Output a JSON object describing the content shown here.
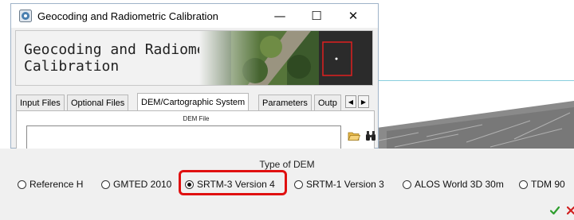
{
  "window": {
    "title": "Geocoding and Radiometric Calibration",
    "controls": {
      "minimize": "—",
      "maximize": "☐",
      "close": "✕"
    }
  },
  "banner": {
    "title": "Geocoding and Radiometric\nCalibration"
  },
  "tabs": [
    {
      "label": "Input Files",
      "active": false
    },
    {
      "label": "Optional Files",
      "active": false
    },
    {
      "label": "DEM/Cartographic System",
      "active": true
    },
    {
      "label": "Parameters",
      "active": false
    },
    {
      "label": "Outp",
      "active": false
    }
  ],
  "tab_scroll": {
    "left": "◀",
    "right": "▶"
  },
  "dem_file": {
    "label": "DEM File",
    "value": ""
  },
  "dem_type": {
    "legend": "Type of DEM",
    "options": [
      {
        "label": "Reference H",
        "selected": false
      },
      {
        "label": "GMTED 2010",
        "selected": false
      },
      {
        "label": "SRTM-3 Version 4",
        "selected": true
      },
      {
        "label": "SRTM-1 Version 3",
        "selected": false
      },
      {
        "label": "ALOS World 3D 30m",
        "selected": false
      },
      {
        "label": "TDM 90",
        "selected": false
      }
    ]
  },
  "colors": {
    "highlight": "#e01010",
    "ok": "#2e9e2e",
    "cancel": "#d02020",
    "accent_line": "#88cede"
  },
  "icons": {
    "app": "app-icon",
    "folder": "folder-open-icon",
    "search": "binoculars-icon",
    "ok": "check-icon",
    "cancel": "x-icon"
  }
}
